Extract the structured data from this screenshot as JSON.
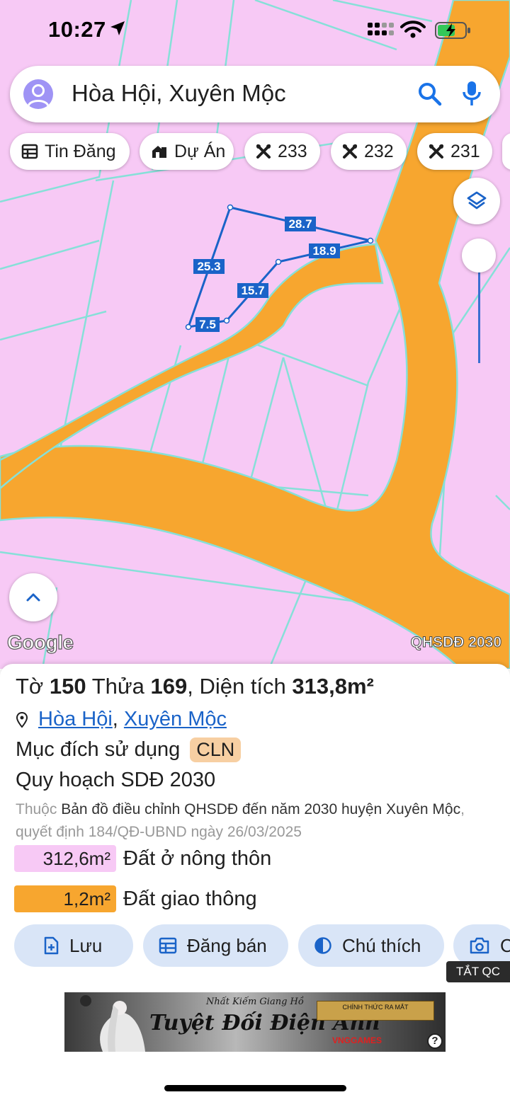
{
  "status_bar": {
    "time": "10:27"
  },
  "search": {
    "text": "Hòa Hội, Xuyên Mộc"
  },
  "chips": [
    {
      "label": "Tin Đăng",
      "icon": "table-icon"
    },
    {
      "label": "Dự Án",
      "icon": "building-icon"
    },
    {
      "label": "233",
      "icon": "tools-icon"
    },
    {
      "label": "232",
      "icon": "tools-icon"
    },
    {
      "label": "231",
      "icon": "tools-icon"
    }
  ],
  "map": {
    "edge_labels": [
      "28.7",
      "18.9",
      "25.3",
      "15.7",
      "7.5"
    ],
    "attribution": "Google",
    "layer_name": "QHSDĐ 2030",
    "colors": {
      "land": "#f7c9f5",
      "road": "#f7a62f",
      "parcel_line": "#86e0d8",
      "boundary": "#1a63c8"
    }
  },
  "parcel": {
    "to_label": "Tờ",
    "to_value": "150",
    "thua_label": "Thửa",
    "thua_value": "169",
    "area_label": "Diện tích",
    "area_value": "313,8m²",
    "commune": "Hòa Hội",
    "district": "Xuyên Mộc",
    "purpose_label": "Mục đích sử dụng",
    "purpose_code": "CLN",
    "plan_label": "Quy hoạch SDĐ 2030",
    "desc_prefix": "Thuộc",
    "desc_main": "Bản đồ điều chỉnh QHSDĐ đến năm 2030 huyện Xuyên Mộc",
    "desc_suffix": ", quyết định 184/QĐ-UBND ngày 26/03/2025",
    "land_uses": [
      {
        "area": "312,6m²",
        "label": "Đất ở nông thôn",
        "color": "#f7c9f5"
      },
      {
        "area": "1,2m²",
        "label": "Đất giao thông",
        "color": "#f7a62f"
      }
    ]
  },
  "actions": [
    {
      "label": "Lưu",
      "icon": "add-file-icon"
    },
    {
      "label": "Đăng bán",
      "icon": "table-icon"
    },
    {
      "label": "Chú thích",
      "icon": "contrast-icon"
    },
    {
      "label": "C",
      "icon": "camera-icon"
    }
  ],
  "ad": {
    "close_label": "TẮT QC",
    "game_logo": "Nhất Kiếm Giang Hồ",
    "title": "Tuyệt Đối Điện Ảnh",
    "launch": "CHÍNH THỨC RA MẮT",
    "publisher": "VNGGAMES"
  }
}
